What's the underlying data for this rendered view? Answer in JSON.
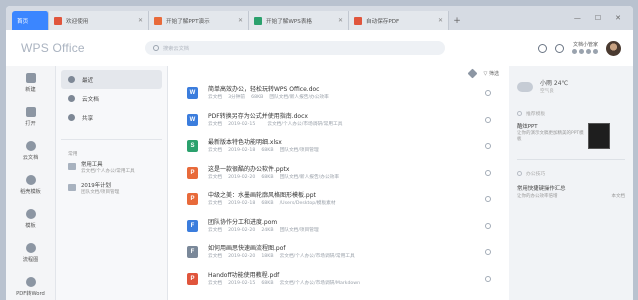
{
  "tabs": [
    {
      "label": "首页",
      "color": "#3b86ff"
    },
    {
      "label": "欢迎使用",
      "color": "#e0553c"
    },
    {
      "label": "开始了解PPT演示",
      "color": "#e86a3a"
    },
    {
      "label": "开始了解WPS表格",
      "color": "#2ba16d"
    },
    {
      "label": "自动保存PDF",
      "color": "#e0553c"
    }
  ],
  "header": {
    "logo": "WPS Office",
    "search_placeholder": "搜索云文档",
    "user_name": "文档小管家"
  },
  "rail": [
    {
      "label": "新建",
      "icon": "plus-icon"
    },
    {
      "label": "打开",
      "icon": "folder-icon"
    },
    {
      "label": "云文档",
      "icon": "cloud-icon"
    },
    {
      "label": "稻壳模板",
      "icon": "template-icon"
    },
    {
      "label": "模板",
      "icon": "grid-icon"
    },
    {
      "label": "流程图",
      "icon": "flow-icon"
    },
    {
      "label": "PDF转Word",
      "icon": "pdf-icon"
    }
  ],
  "nav": {
    "items": [
      {
        "label": "最近",
        "active": true
      },
      {
        "label": "云文档",
        "active": false
      },
      {
        "label": "共享",
        "active": false
      }
    ],
    "group_label": "常用",
    "folders": [
      {
        "title": "常用工具",
        "sub": "云文档/个人办公/常用工具"
      },
      {
        "title": "2019年计划",
        "sub": "团队文档/项目管理"
      }
    ]
  },
  "toolbar": {
    "filter_label": "筛选"
  },
  "files": [
    {
      "name": "简单高效办公，轻松玩转WPS Office.doc",
      "type": "W",
      "color": "#3b7ddd",
      "time": "3分钟前",
      "size": "68KB",
      "location": "团队文档/新人报告/办公效率"
    },
    {
      "name": "PDF转换另存为公式并使用指南.docx",
      "type": "W",
      "color": "#3b7ddd",
      "time": "2019-02-15",
      "size": "",
      "location": "云文档/个人办公/市场调研/常用工具"
    },
    {
      "name": "最新版本特色功能明细.xlsx",
      "type": "S",
      "color": "#2ba16d",
      "time": "2019-02-18",
      "size": "68KB",
      "location": "团队文档/项目管理"
    },
    {
      "name": "这是一款很酷的办公软件.pptx",
      "type": "P",
      "color": "#e86a3a",
      "time": "2019-02-20",
      "size": "68KB",
      "location": "团队文档/新人报告/办公效率"
    },
    {
      "name": "中级之美：水墨画轮廓风格图形模板.ppt",
      "type": "P",
      "color": "#e86a3a",
      "time": "2019-02-18",
      "size": "68KB",
      "location": "/Users/Desktop/模板素材"
    },
    {
      "name": "团队协作分工和进度.pom",
      "type": "F",
      "color": "#3b7ddd",
      "time": "2019-02-20",
      "size": "24KB",
      "location": "团队文档/项目管理"
    },
    {
      "name": "如何用画思快速画流程图.pof",
      "type": "F",
      "color": "#7a8899",
      "time": "2019-02-20",
      "size": "18KB",
      "location": "云文档/个人办公/市场调研/常用工具"
    },
    {
      "name": "Handoff功能使用教程.pdf",
      "type": "P",
      "color": "#e0553c",
      "time": "2019-02-15",
      "size": "68KB",
      "location": "云文档/个人办公/市场调研/Markdown"
    }
  ],
  "file_location_prefix": "云文档",
  "weather": {
    "main": "小雨 24℃",
    "sub": "空气良"
  },
  "side": {
    "recommend_title": "推荐模板",
    "card_title": "酷炫PPT",
    "card_sub": "让你的演示文稿更加精美的PPT模板",
    "skills_title": "办公技巧",
    "tip_title": "常用快捷键操作汇总",
    "tip_sub": "让你的办公效率倍增",
    "tip_count": "本文档"
  }
}
